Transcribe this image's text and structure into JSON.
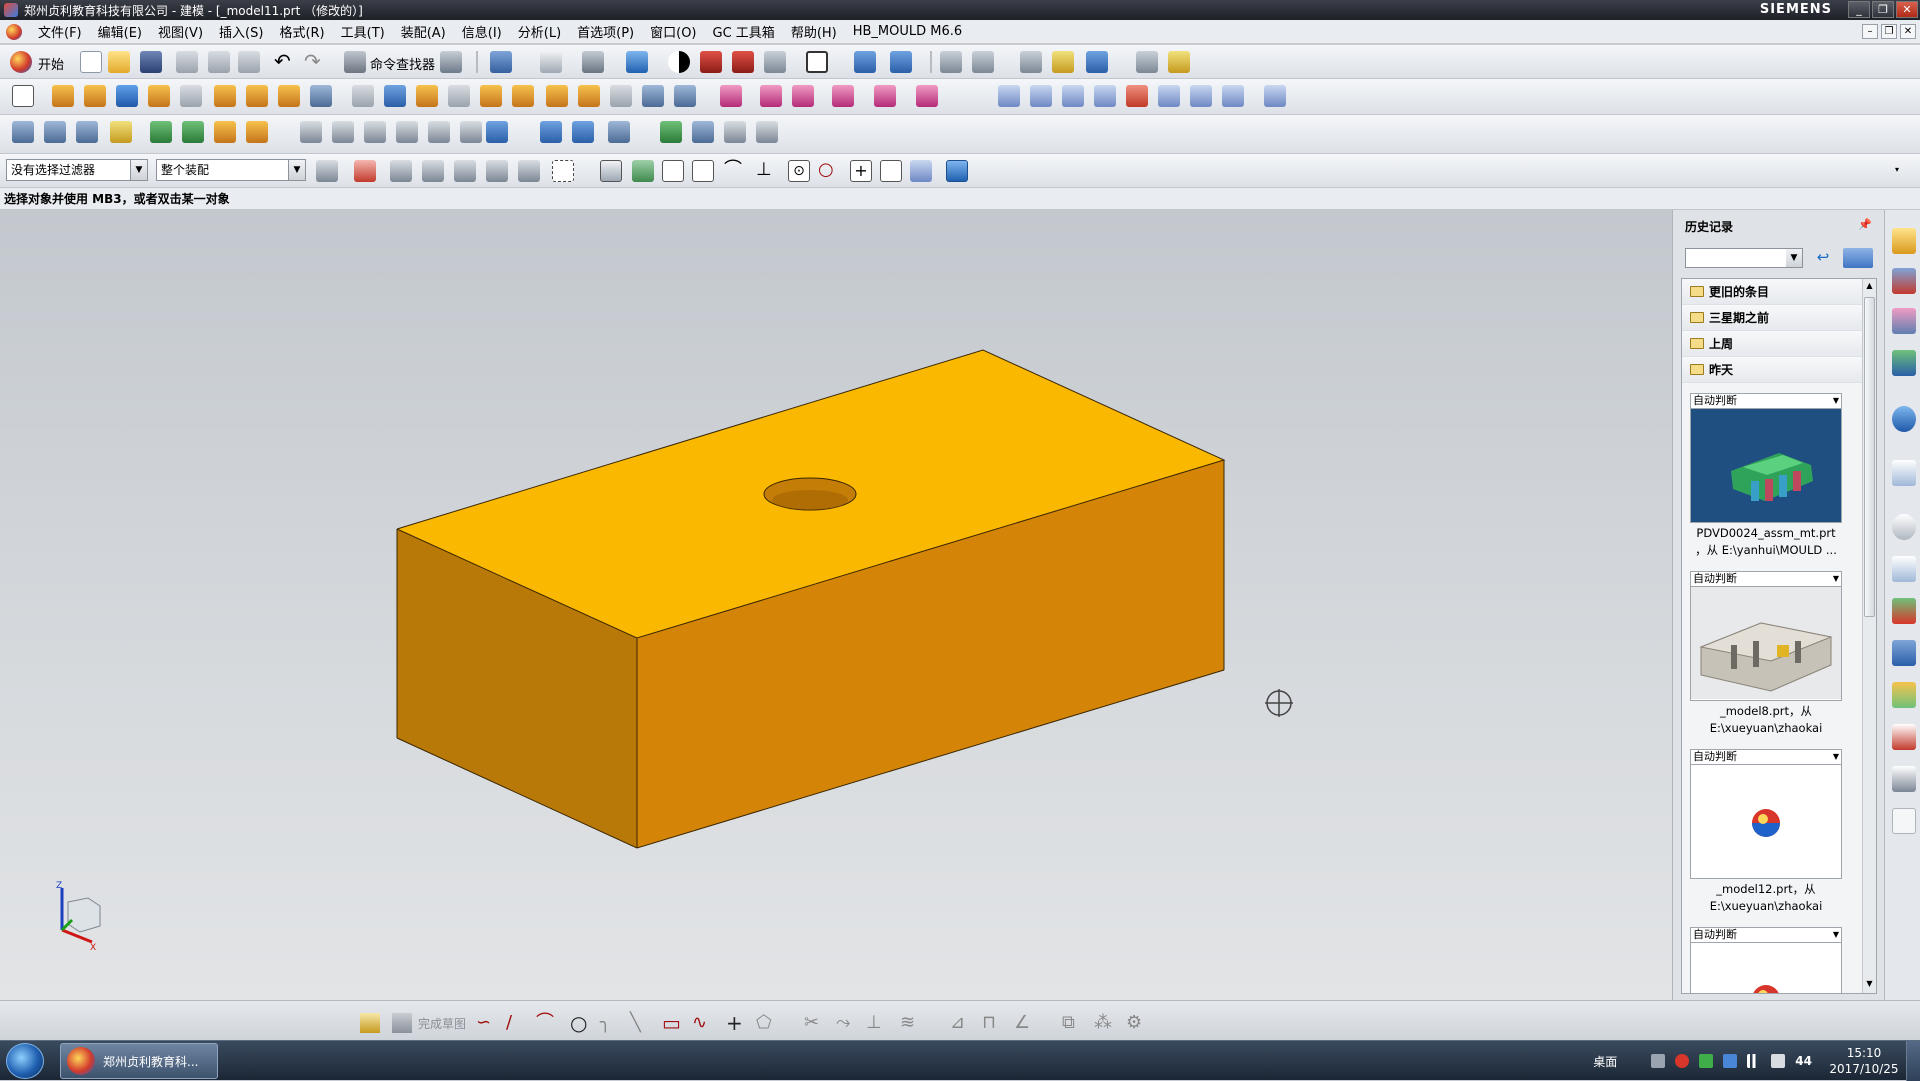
{
  "window": {
    "title": "郑州贞利教育科技有限公司 - 建模 - [_model11.prt （修改的）]",
    "brand": "SIEMENS",
    "buttons": [
      "_",
      "❐",
      "✕"
    ]
  },
  "menubar": {
    "items": [
      "文件(F)",
      "编辑(E)",
      "视图(V)",
      "插入(S)",
      "格式(R)",
      "工具(T)",
      "装配(A)",
      "信息(I)",
      "分析(L)",
      "首选项(P)",
      "窗口(O)",
      "GC 工具箱",
      "帮助(H)",
      "HB_MOULD M6.6"
    ],
    "mdi_buttons": [
      "–",
      "❐",
      "✕"
    ]
  },
  "toolbar1": {
    "start_label": "开始",
    "command_finder_label": "命令查找器"
  },
  "selection_bar": {
    "filter_value": "没有选择过滤器",
    "scope_value": "整个装配"
  },
  "cue_line": "选择对象并使用 MB3，或者双击某一对象",
  "viewport": {
    "model_colors": {
      "top": "#fbb800",
      "front": "#d48508",
      "left": "#b87908",
      "hole": "#c47d06",
      "hole_inner": "#9a5c02"
    },
    "triad_labels": [
      "Z",
      "X"
    ]
  },
  "history": {
    "title": "历史记录",
    "pin": "📌",
    "groups": [
      "更旧的条目",
      "三星期之前",
      "上周",
      "昨天"
    ],
    "items": [
      {
        "mode": "自动判断",
        "thumb": "assembly-mould",
        "caption_line1": "PDVD0024_assm_mt.prt",
        "caption_line2": "，从 E:\\yanhui\\MOULD ..."
      },
      {
        "mode": "自动判断",
        "thumb": "building-model",
        "caption_line1": "_model8.prt，从",
        "caption_line2": "E:\\xueyuan\\zhaokai"
      },
      {
        "mode": "自动判断",
        "thumb": "nx-logo",
        "caption_line1": "_model12.prt，从",
        "caption_line2": "E:\\xueyuan\\zhaokai"
      },
      {
        "mode": "自动判断",
        "thumb": "nx-logo",
        "caption_line1": "",
        "caption_line2": ""
      }
    ]
  },
  "sketch_toolbar": {
    "finish_label": "完成草图"
  },
  "taskbar": {
    "app_label": "郑州贞利教育科...",
    "desktop_label": "桌面",
    "tray_num": "44",
    "time": "15:10",
    "date": "2017/10/25"
  }
}
